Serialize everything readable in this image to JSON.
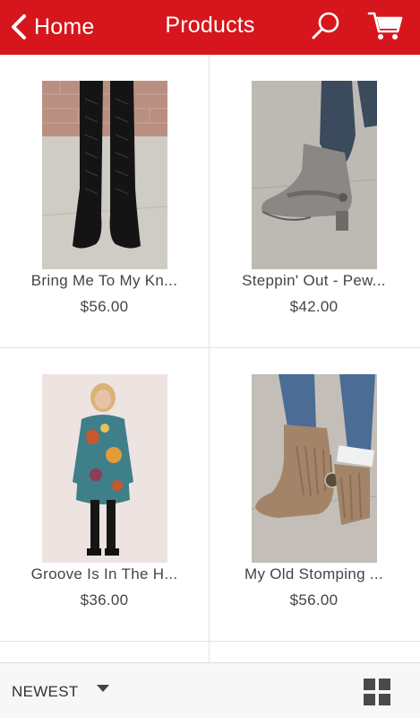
{
  "header": {
    "back_label": "Home",
    "title": "Products",
    "background_color": "#d6161c",
    "back_icon": "chevron-left-icon",
    "search_icon": "search-icon",
    "cart_icon": "cart-icon"
  },
  "products": [
    {
      "name": "Bring Me To My Kn...",
      "price": "$56.00",
      "image": "black-lace-up-knee-boots"
    },
    {
      "name": "Steppin' Out - Pew...",
      "price": "$42.00",
      "image": "pewter-ankle-booties"
    },
    {
      "name": "Groove Is In The H...",
      "price": "$36.00",
      "image": "paisley-tunic-dress"
    },
    {
      "name": "My Old Stomping ...",
      "price": "$56.00",
      "image": "taupe-fringe-booties"
    }
  ],
  "bottom_bar": {
    "sort_label": "NEWEST",
    "sort_icon": "caret-down-icon",
    "view_icon": "grid-view-icon"
  }
}
